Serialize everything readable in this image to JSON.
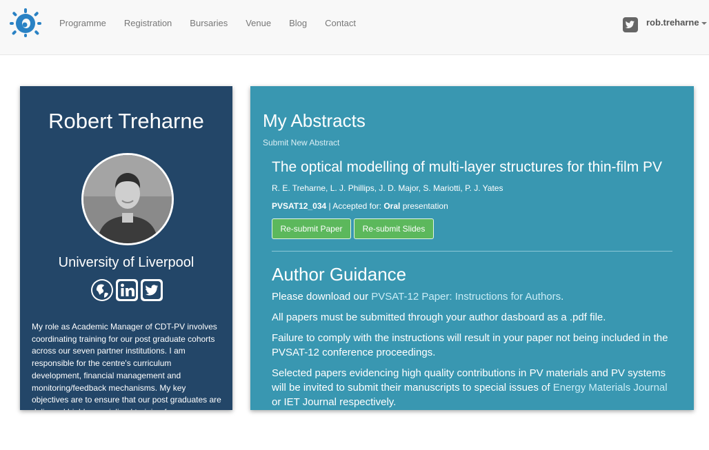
{
  "nav": {
    "items": [
      "Programme",
      "Registration",
      "Bursaries",
      "Venue",
      "Blog",
      "Contact"
    ],
    "username": "rob.treharne"
  },
  "profile": {
    "name": "Robert Treharne",
    "institution": "University of Liverpool",
    "bio": "My role as Academic Manager of CDT-PV involves coordinating training for our post graduate cohorts across our seven partner institutions. I am responsible for the centre's curriculum development, financial management and monitoring/feedback mechanisms. My key objectives are to ensure that our post graduates are delivered highly specialised training for"
  },
  "abstracts": {
    "title": "My Abstracts",
    "submit_link": "Submit New Abstract",
    "item": {
      "title": "The optical modelling of multi-layer structures for thin-film PV",
      "authors": "R. E. Treharne, L. J. Phillips, J. D. Major, S. Mariotti, P. J. Yates",
      "id": "PVSAT12_034",
      "status_prefix": " | Accepted for: ",
      "presentation_type": "Oral",
      "status_suffix": " presentation",
      "resubmit_paper": "Re-submit Paper",
      "resubmit_slides": "Re-submit Slides"
    }
  },
  "guidance": {
    "title": "Author Guidance",
    "p1_before": "Please download our ",
    "p1_link": "PVSAT-12 Paper: Instructions for Authors",
    "p1_after": ".",
    "p2": "All papers must be submitted through your author dasboard as a .pdf file.",
    "p3": "Failure to comply with the instructions will result in your paper not being included in the PVSAT-12 conference proceedings.",
    "p4_before": "Selected papers evidencing high quality contributions in PV materials and PV systems will be invited to submit their manuscripts to special issues of ",
    "p4_link": "Energy Materials Journal",
    "p4_after": " or IET Journal respectively."
  },
  "colors": {
    "navbar_bg": "#f8f8f8",
    "profile_bg": "#234668",
    "main_bg": "#3997b1",
    "button_green": "#5cb85c"
  },
  "icons": [
    "logo-icon",
    "twitter-icon",
    "globe-icon",
    "linkedin-icon",
    "caret-down-icon"
  ]
}
